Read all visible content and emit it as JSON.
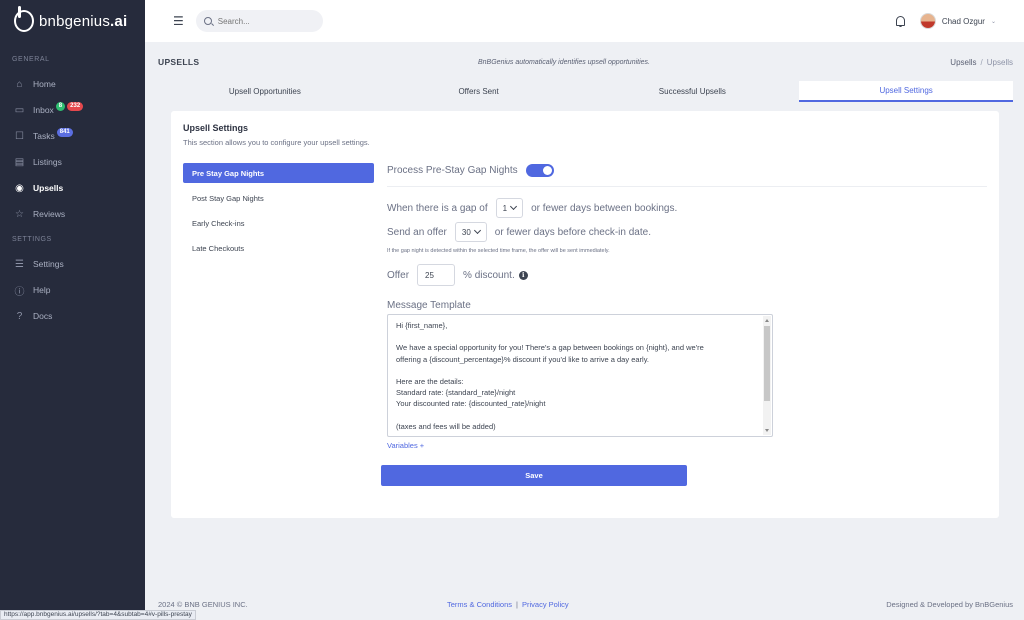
{
  "brand": {
    "name_light": "bnbgenius",
    "name_bold": ".ai"
  },
  "sidebar": {
    "general_label": "GENERAL",
    "settings_label": "SETTINGS",
    "items": [
      {
        "label": "Home",
        "icon": "home-icon"
      },
      {
        "label": "Inbox",
        "icon": "inbox-icon",
        "badges": [
          "8",
          "232"
        ]
      },
      {
        "label": "Tasks",
        "icon": "tasks-icon",
        "badges": [
          "841"
        ]
      },
      {
        "label": "Listings",
        "icon": "listings-icon"
      },
      {
        "label": "Upsells",
        "icon": "upsells-icon",
        "active": true
      },
      {
        "label": "Reviews",
        "icon": "star-icon"
      }
    ],
    "settings_items": [
      {
        "label": "Settings",
        "icon": "sliders-icon"
      },
      {
        "label": "Help",
        "icon": "help-icon"
      },
      {
        "label": "Docs",
        "icon": "question-icon"
      }
    ]
  },
  "topbar": {
    "search_placeholder": "Search...",
    "user_name": "Chad Ozgur"
  },
  "page": {
    "title": "UPSELLS",
    "subtitle": "BnBGenius automatically identifies upsell opportunities.",
    "breadcrumb": [
      "Upsells",
      "/",
      "Upsells"
    ]
  },
  "tabs": [
    {
      "label": "Upsell Opportunities",
      "active": false
    },
    {
      "label": "Offers Sent",
      "active": false
    },
    {
      "label": "Successful Upsells",
      "active": false
    },
    {
      "label": "Upsell Settings",
      "active": true
    }
  ],
  "card": {
    "title": "Upsell Settings",
    "description": "This section allows you to configure your upsell settings.",
    "pills": [
      {
        "label": "Pre Stay Gap Nights",
        "active": true
      },
      {
        "label": "Post Stay Gap Nights",
        "active": false
      },
      {
        "label": "Early Check-ins",
        "active": false
      },
      {
        "label": "Late Checkouts",
        "active": false
      }
    ]
  },
  "settings": {
    "process_label": "Process Pre-Stay Gap Nights",
    "process_enabled": true,
    "gap_prefix": "When there is a gap of",
    "gap_value": "1",
    "gap_suffix": "or fewer days between bookings.",
    "offer_prefix": "Send an offer",
    "offer_value": "30",
    "offer_suffix": "or fewer days before check-in date.",
    "hint": "If the gap night is detected within the selected time frame, the offer will be sent immediately.",
    "discount_prefix": "Offer",
    "discount_value": "25",
    "discount_suffix": "% discount.",
    "template_label": "Message Template",
    "template_lines": [
      "Hi {first_name},",
      "",
      "We have a special opportunity for you! There's a gap between bookings on {night}, and we're",
      "offering a {discount_percentage}% discount if you'd like to arrive a day early.",
      "",
      "Here are the details:",
      "Standard rate: {standard_rate}/night",
      "Your discounted rate: {discounted_rate}/night",
      "",
      "(taxes and fees will be added)"
    ],
    "variables_link": "Variables +",
    "save_label": "Save"
  },
  "footer": {
    "copyright": "2024 © BNB GENIUS INC.",
    "terms": "Terms & Conditions",
    "sep": "|",
    "privacy": "Privacy Policy",
    "credit": "Designed & Developed by BnBGenius"
  },
  "status_url": "https://app.bnbgenius.ai/upsells/?tab=4&subtab=4#v-pills-prestay",
  "colors": {
    "accent": "#5068e0",
    "sidebar": "#262b3c",
    "badge_green": "#2fbf71",
    "badge_red": "#e5484d"
  }
}
